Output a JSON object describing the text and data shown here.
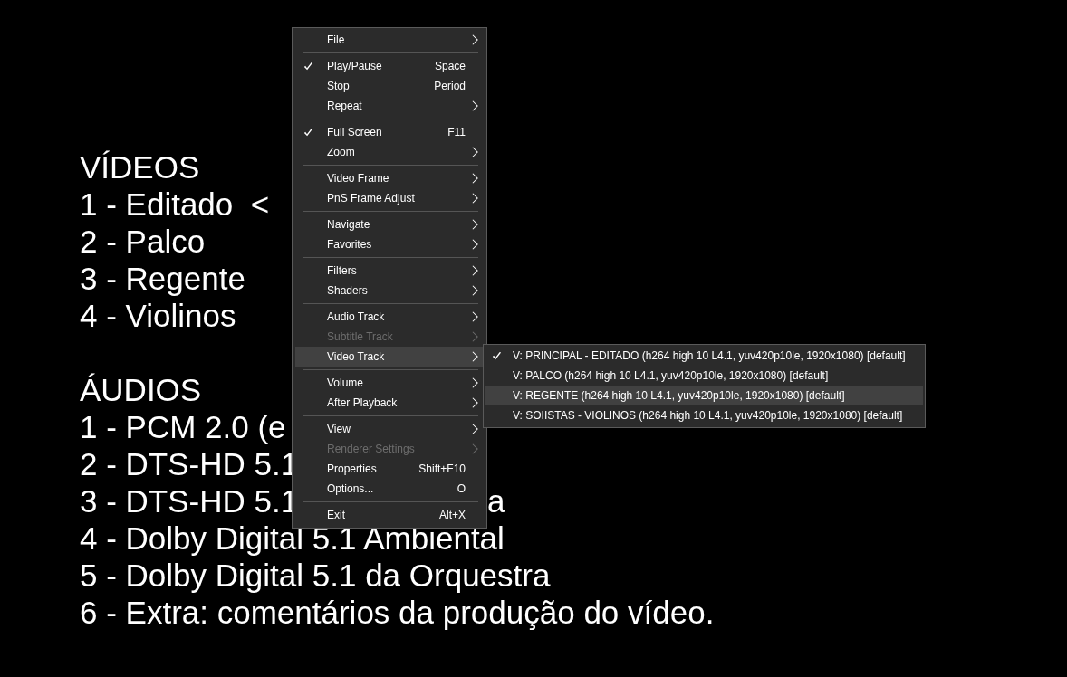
{
  "video_frame": {
    "sections": [
      {
        "heading": "VÍDEOS",
        "lines": [
          {
            "text": "1 - Editado  <"
          },
          {
            "text": "2 - Palco"
          },
          {
            "text": "3 - Regente"
          },
          {
            "text": "4 - Violinos"
          }
        ]
      },
      {
        "heading": "ÁUDIOS",
        "lines": [
          {
            "text": "1 - PCM 2.0 (e"
          },
          {
            "text": "2 - DTS-HD 5.1"
          },
          {
            "text": "3 - DTS-HD 5.1",
            "tail": "a"
          },
          {
            "text": "4 - Dolby Digital 5.1 Ambiental"
          },
          {
            "text": "5 - Dolby Digital 5.1 da Orquestra"
          },
          {
            "text": "6 - Extra: comentários da produção do vídeo."
          }
        ]
      }
    ]
  },
  "context_menu": {
    "groups": [
      [
        {
          "label": "File",
          "checked": false,
          "submenu": true,
          "disabled": false,
          "selected": false
        }
      ],
      [
        {
          "label": "Play/Pause",
          "shortcut": "Space",
          "checked": true,
          "submenu": false,
          "disabled": false,
          "selected": false
        },
        {
          "label": "Stop",
          "shortcut": "Period",
          "checked": false,
          "submenu": false,
          "disabled": false,
          "selected": false
        },
        {
          "label": "Repeat",
          "checked": false,
          "submenu": true,
          "disabled": false,
          "selected": false
        }
      ],
      [
        {
          "label": "Full Screen",
          "shortcut": "F11",
          "checked": true,
          "submenu": false,
          "disabled": false,
          "selected": false
        },
        {
          "label": "Zoom",
          "checked": false,
          "submenu": true,
          "disabled": false,
          "selected": false
        }
      ],
      [
        {
          "label": "Video Frame",
          "checked": false,
          "submenu": true,
          "disabled": false,
          "selected": false
        },
        {
          "label": "PnS Frame Adjust",
          "checked": false,
          "submenu": true,
          "disabled": false,
          "selected": false
        }
      ],
      [
        {
          "label": "Navigate",
          "checked": false,
          "submenu": true,
          "disabled": false,
          "selected": false
        },
        {
          "label": "Favorites",
          "checked": false,
          "submenu": true,
          "disabled": false,
          "selected": false
        }
      ],
      [
        {
          "label": "Filters",
          "checked": false,
          "submenu": true,
          "disabled": false,
          "selected": false
        },
        {
          "label": "Shaders",
          "checked": false,
          "submenu": true,
          "disabled": false,
          "selected": false
        }
      ],
      [
        {
          "label": "Audio Track",
          "checked": false,
          "submenu": true,
          "disabled": false,
          "selected": false
        },
        {
          "label": "Subtitle Track",
          "checked": false,
          "submenu": true,
          "disabled": true,
          "selected": false
        },
        {
          "label": "Video Track",
          "checked": false,
          "submenu": true,
          "disabled": false,
          "selected": true
        }
      ],
      [
        {
          "label": "Volume",
          "checked": false,
          "submenu": true,
          "disabled": false,
          "selected": false
        },
        {
          "label": "After Playback",
          "checked": false,
          "submenu": true,
          "disabled": false,
          "selected": false
        }
      ],
      [
        {
          "label": "View",
          "checked": false,
          "submenu": true,
          "disabled": false,
          "selected": false
        },
        {
          "label": "Renderer Settings",
          "checked": false,
          "submenu": true,
          "disabled": true,
          "selected": false
        },
        {
          "label": "Properties",
          "shortcut": "Shift+F10",
          "checked": false,
          "submenu": false,
          "disabled": false,
          "selected": false
        },
        {
          "label": "Options...",
          "shortcut": "O",
          "checked": false,
          "submenu": false,
          "disabled": false,
          "selected": false
        }
      ],
      [
        {
          "label": "Exit",
          "shortcut": "Alt+X",
          "checked": false,
          "submenu": false,
          "disabled": false,
          "selected": false
        }
      ]
    ]
  },
  "video_track_submenu": {
    "items": [
      {
        "label": "V: PRINCIPAL - EDITADO (h264 high 10 L4.1, yuv420p10le, 1920x1080) [default]",
        "checked": true,
        "selected": false
      },
      {
        "label": "V: PALCO (h264 high 10 L4.1, yuv420p10le, 1920x1080) [default]",
        "checked": false,
        "selected": false
      },
      {
        "label": "V: REGENTE (h264 high 10 L4.1, yuv420p10le, 1920x1080) [default]",
        "checked": false,
        "selected": true
      },
      {
        "label": "V: SOIISTAS - VIOLINOS (h264 high 10 L4.1, yuv420p10le, 1920x1080) [default]",
        "checked": false,
        "selected": false
      }
    ]
  }
}
